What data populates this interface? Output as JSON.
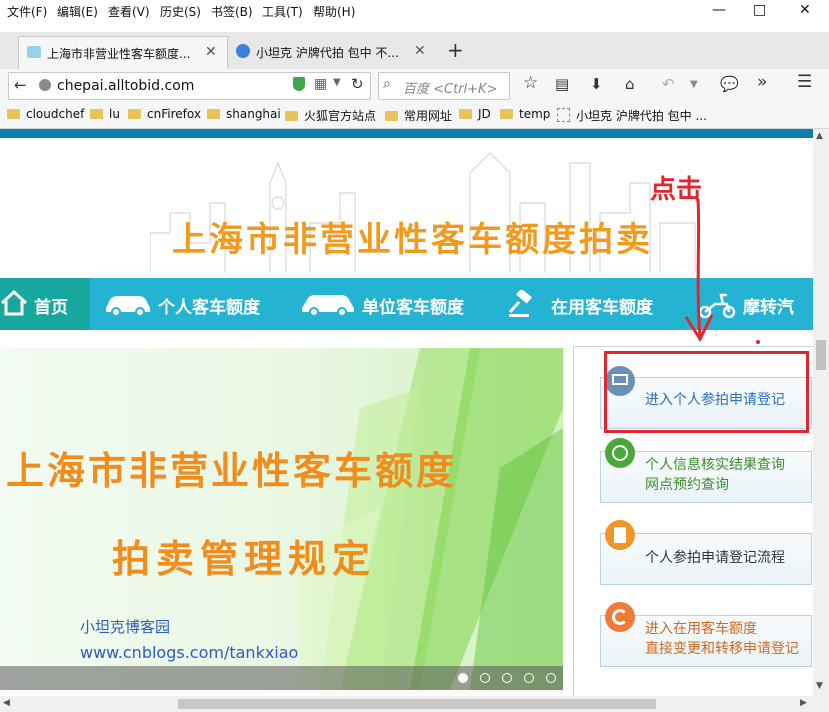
{
  "menubar": {
    "items": [
      "文件(F)",
      "编辑(E)",
      "查看(V)",
      "历史(S)",
      "书签(B)",
      "工具(T)",
      "帮助(H)"
    ]
  },
  "window_controls": {
    "minimize": "—",
    "maximize": "□",
    "close": "✕"
  },
  "tabs": [
    {
      "title": "上海市非营业性客车额度...",
      "active": true
    },
    {
      "title": "小坦克 沪牌代拍 包中 不...",
      "active": false
    }
  ],
  "new_tab": "+",
  "address": {
    "url": "chepai.alltobid.com",
    "search_placeholder": "百度 <Ctrl+K>"
  },
  "bookmarks": [
    "cloudchef",
    "lu",
    "cnFirefox",
    "shanghai",
    "火狐官方站点",
    "常用网址",
    "JD",
    "temp",
    "小坦克 沪牌代拍 包中 ..."
  ],
  "overflow": "»",
  "page": {
    "banner_title": "上海市非营业性客车额度拍卖",
    "annotation": "点击",
    "nav": [
      "首页",
      "个人客车额度",
      "单位客车额度",
      "在用客车额度",
      "摩转汽"
    ],
    "slide": {
      "title_line1": "上海市非营业性客车额度",
      "title_line2": "拍卖管理规定",
      "blog_name": "小坦克博客园",
      "blog_url": "www.cnblogs.com/tankxiao",
      "dots": 5,
      "active_dot": 0
    },
    "side": [
      {
        "line1": "进入个人参拍申请登记",
        "line2": "",
        "icon": "laptop-icon",
        "color": "#2b6fbf"
      },
      {
        "line1": "个人信息核实结果查询",
        "line2": "网点预约查询",
        "icon": "globe-icon",
        "color": "#3a8f2a"
      },
      {
        "line1": "个人参拍申请登记流程",
        "line2": "",
        "icon": "document-icon",
        "color": "#333333"
      },
      {
        "line1": "进入在用客车额度",
        "line2": "直接变更和转移申请登记",
        "icon": "refresh-icon",
        "color": "#d2691e"
      }
    ]
  },
  "colors": {
    "nav_blue": "#25b3d4",
    "nav_green": "#18a79e",
    "orange": "#f39a1c",
    "red": "#e0262e"
  }
}
